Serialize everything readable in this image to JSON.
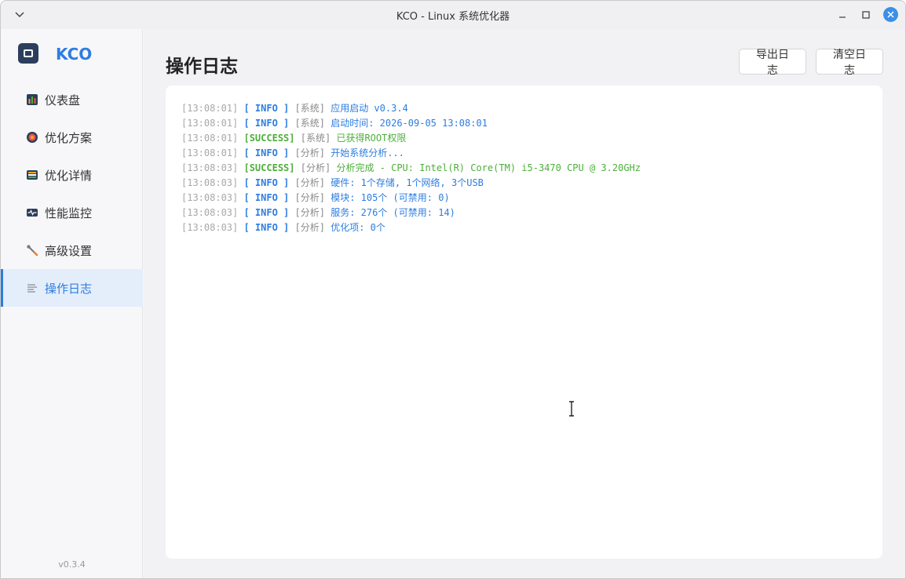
{
  "window": {
    "title": "KCO - Linux 系统优化器"
  },
  "brand": {
    "name": "KCO"
  },
  "sidebar": {
    "items": [
      {
        "label": "仪表盘",
        "icon": "dashboard-icon"
      },
      {
        "label": "优化方案",
        "icon": "target-icon"
      },
      {
        "label": "优化详情",
        "icon": "list-icon"
      },
      {
        "label": "性能监控",
        "icon": "monitor-icon"
      },
      {
        "label": "高级设置",
        "icon": "wrench-icon"
      },
      {
        "label": "操作日志",
        "icon": "log-icon",
        "active": true
      }
    ],
    "version": "v0.3.4"
  },
  "main": {
    "title": "操作日志",
    "export_label": "导出日志",
    "clear_label": "清空日志"
  },
  "logs": [
    {
      "time": "[13:08:01]",
      "level": "[ INFO ]",
      "category": "[系统]",
      "message": "应用启动 v0.3.4",
      "type": "info"
    },
    {
      "time": "[13:08:01]",
      "level": "[ INFO ]",
      "category": "[系统]",
      "message": "启动时间: 2026-09-05 13:08:01",
      "type": "info"
    },
    {
      "time": "[13:08:01]",
      "level": "[SUCCESS]",
      "category": "[系统]",
      "message": "已获得ROOT权限",
      "type": "success"
    },
    {
      "time": "[13:08:01]",
      "level": "[ INFO ]",
      "category": "[分析]",
      "message": "开始系统分析...",
      "type": "info"
    },
    {
      "time": "[13:08:03]",
      "level": "[SUCCESS]",
      "category": "[分析]",
      "message": "分析完成 - CPU: Intel(R) Core(TM) i5-3470 CPU @ 3.20GHz",
      "type": "success"
    },
    {
      "time": "[13:08:03]",
      "level": "[ INFO ]",
      "category": "[分析]",
      "message": "硬件: 1个存储, 1个网络, 3个USB",
      "type": "info"
    },
    {
      "time": "[13:08:03]",
      "level": "[ INFO ]",
      "category": "[分析]",
      "message": "模块: 105个 (可禁用: 0)",
      "type": "info"
    },
    {
      "time": "[13:08:03]",
      "level": "[ INFO ]",
      "category": "[分析]",
      "message": "服务: 276个 (可禁用: 14)",
      "type": "info"
    },
    {
      "time": "[13:08:03]",
      "level": "[ INFO ]",
      "category": "[分析]",
      "message": "优化项: 0个",
      "type": "info"
    }
  ],
  "colors": {
    "accent": "#2d7de0",
    "success": "#4caf3a",
    "muted": "#a8a8ac"
  }
}
